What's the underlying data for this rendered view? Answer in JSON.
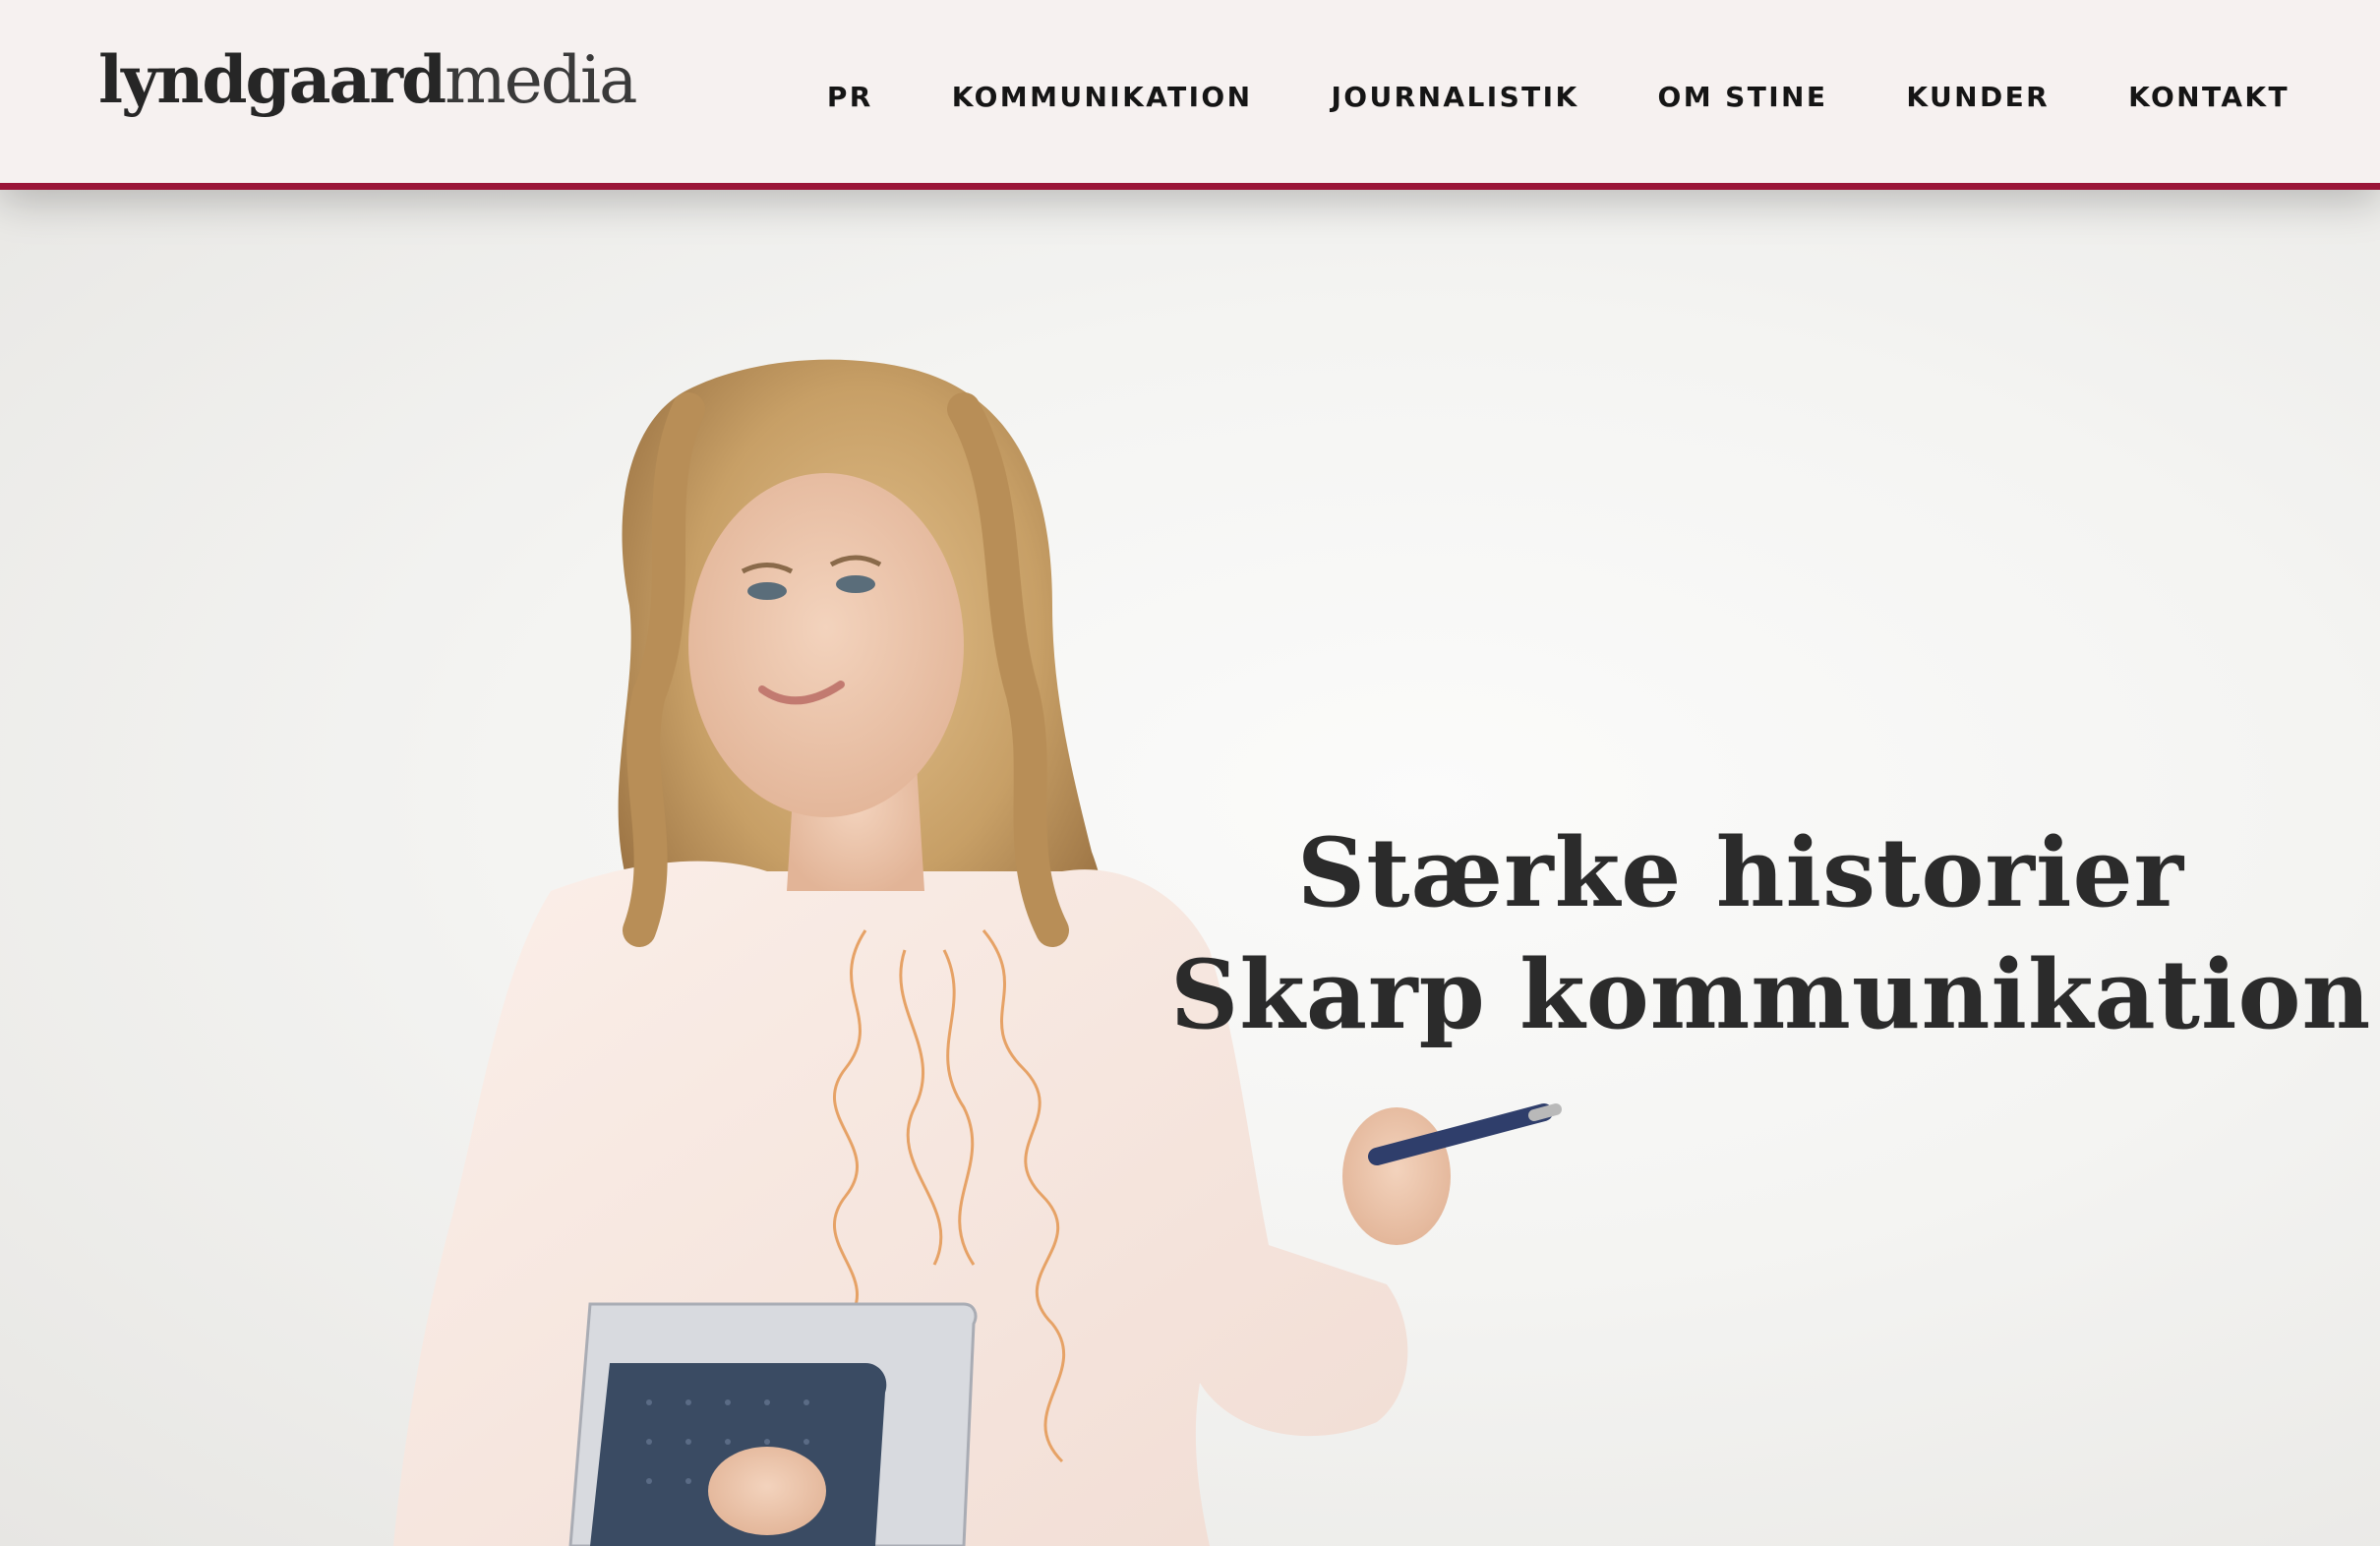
{
  "brand": {
    "logo_bold": "lyndgaard",
    "logo_light": "media",
    "accent_color": "#9a1538"
  },
  "nav": {
    "items": [
      {
        "label": "PR"
      },
      {
        "label": "KOMMUNIKATION"
      },
      {
        "label": "JOURNALISTIK"
      },
      {
        "label": "OM STINE"
      },
      {
        "label": "KUNDER"
      },
      {
        "label": "KONTAKT"
      }
    ]
  },
  "hero": {
    "headline_line1": "Stærke historier",
    "headline_line2": "Skarp kommunikation",
    "image": "portrait-photo"
  }
}
